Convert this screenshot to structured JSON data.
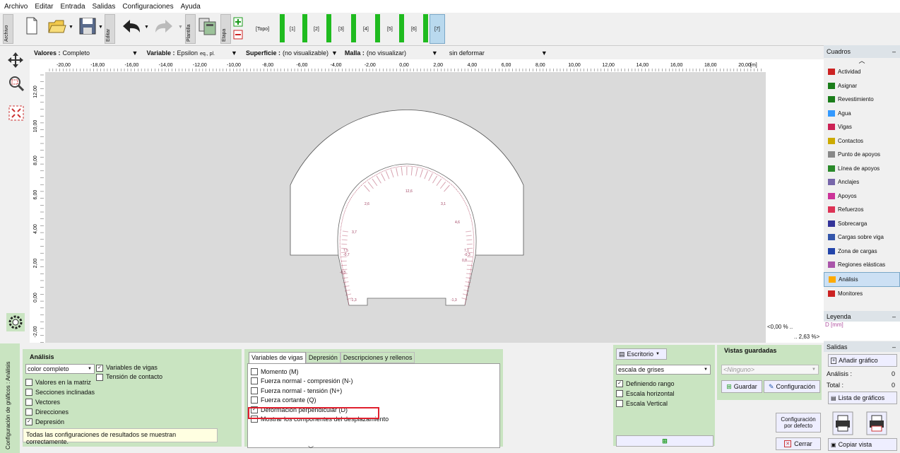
{
  "menu": [
    "Archivo",
    "Editar",
    "Entrada",
    "Salidas",
    "Configuraciones",
    "Ayuda"
  ],
  "toolbar": {
    "archivo_label": "Archivo",
    "editar_label": "Editar",
    "plantilla_label": "Plantilla",
    "etapa_label": "Etapa",
    "stages": [
      "[Topo]",
      "[1]",
      "[2]",
      "[3]",
      "[4]",
      "[5]",
      "[6]",
      "[7]"
    ]
  },
  "controls": {
    "valores_label": "Valores :",
    "valores_value": "Completo",
    "variable_label": "Variable :",
    "variable_value": "Epsilon",
    "variable_sub": "eq., pl.",
    "superficie_label": "Superficie :",
    "superficie_value": "(no visualizable)",
    "malla_label": "Malla :",
    "malla_value": "(no visualizar)",
    "deform_value": "sin deformar"
  },
  "ruler": {
    "h_ticks": [
      "-20,00",
      "-18,00",
      "-16,00",
      "-14,00",
      "-12,00",
      "-10,00",
      "-8,00",
      "-6,00",
      "-4,00",
      "-2,00",
      "0,00",
      "2,00",
      "4,00",
      "6,00",
      "8,00",
      "10,00",
      "12,00",
      "14,00",
      "16,00",
      "18,00",
      "20,00"
    ],
    "unit": "[m]",
    "v_ticks": [
      "12,00",
      "10,00",
      "8,00",
      "6,00",
      "4,00",
      "2,00",
      "0,00",
      "-2,00"
    ]
  },
  "canvas_labels": {
    "scale_min": "<0,00 % ..",
    "scale_max": ".. 2,63 %>",
    "values": [
      "2,6",
      "12,6",
      "3,1",
      "3,7",
      "4,6",
      "7,5",
      "-0,7",
      "7,1",
      "-0,3",
      "0,8",
      "-0,5",
      "-1,3",
      "-1,3"
    ]
  },
  "cuadros": {
    "title": "Cuadros",
    "items": [
      "Actividad",
      "Asignar",
      "Revestimiento",
      "Agua",
      "Vigas",
      "Contactos",
      "Punto de apoyos",
      "Línea de apoyos",
      "Anclajes",
      "Apoyos",
      "Refuerzos",
      "Sobrecarga",
      "Cargas sobre viga",
      "Zona de cargas",
      "Regiones elásticas",
      "Análisis",
      "Monitores"
    ],
    "icon_colors": [
      "#cc2222",
      "#1a7d1a",
      "#1a7d1a",
      "#3399ff",
      "#cc2255",
      "#ccaa00",
      "#888888",
      "#2a8a2a",
      "#7766aa",
      "#cc3399",
      "#dd3355",
      "#333399",
      "#3355aa",
      "#2244aa",
      "#aa55aa",
      "#ffaa00",
      "#cc2222"
    ]
  },
  "leyenda": {
    "title": "Leyenda",
    "unit": "D [mm]"
  },
  "salidas": {
    "title": "Salidas",
    "add_label": "Añadir gráfico",
    "analisis_label": "Análisis :",
    "analisis_count": "0",
    "total_label": "Total :",
    "total_count": "0",
    "list_label": "Lista de gráficos",
    "copy_label": "Copiar vista"
  },
  "bottom": {
    "side_label": "Configuración de gráficos : Análisis",
    "analisis_title": "Análisis",
    "color_select": "color completo",
    "checks_left": [
      {
        "label": "Valores en la matriz",
        "checked": false
      },
      {
        "label": "Secciones inclinadas",
        "checked": false
      },
      {
        "label": "Vectores",
        "checked": false
      },
      {
        "label": "Direcciones",
        "checked": false
      },
      {
        "label": "Depresión",
        "checked": true
      }
    ],
    "check_vigas": {
      "label": "Variables de vigas",
      "checked": true
    },
    "check_contacto": {
      "label": "Tensión de contacto",
      "checked": false
    },
    "status": "Todas las configuraciones de resultados se muestran correctamente.",
    "tabs": [
      "Variables de vigas",
      "Depresión",
      "Descripciones y rellenos"
    ],
    "vigas_checks": [
      {
        "label": "Momento (M)",
        "checked": false
      },
      {
        "label": "Fuerza normal - compresión (N-)",
        "checked": false
      },
      {
        "label": "Fuerza normal - tensión (N+)",
        "checked": false
      },
      {
        "label": "Fuerza cortante (Q)",
        "checked": false
      },
      {
        "label": "Deformación perpendicular (D)",
        "checked": true
      },
      {
        "label": "Mostrar los componentes del desplazamiento",
        "checked": false
      }
    ],
    "escritorio_label": "Escritorio",
    "gray_select": "escala de grises",
    "right_checks": [
      {
        "label": "Definiendo rango",
        "checked": true
      },
      {
        "label": "Escala horizontal",
        "checked": false
      },
      {
        "label": "Escala Vertical",
        "checked": false
      }
    ],
    "vistas_title": "Vistas guardadas",
    "vistas_select": "<Ninguno>",
    "guardar_label": "Guardar",
    "config_label": "Configuración",
    "config_defecto_label": "Configuración por defecto",
    "cerrar_label": "Cerrar"
  }
}
